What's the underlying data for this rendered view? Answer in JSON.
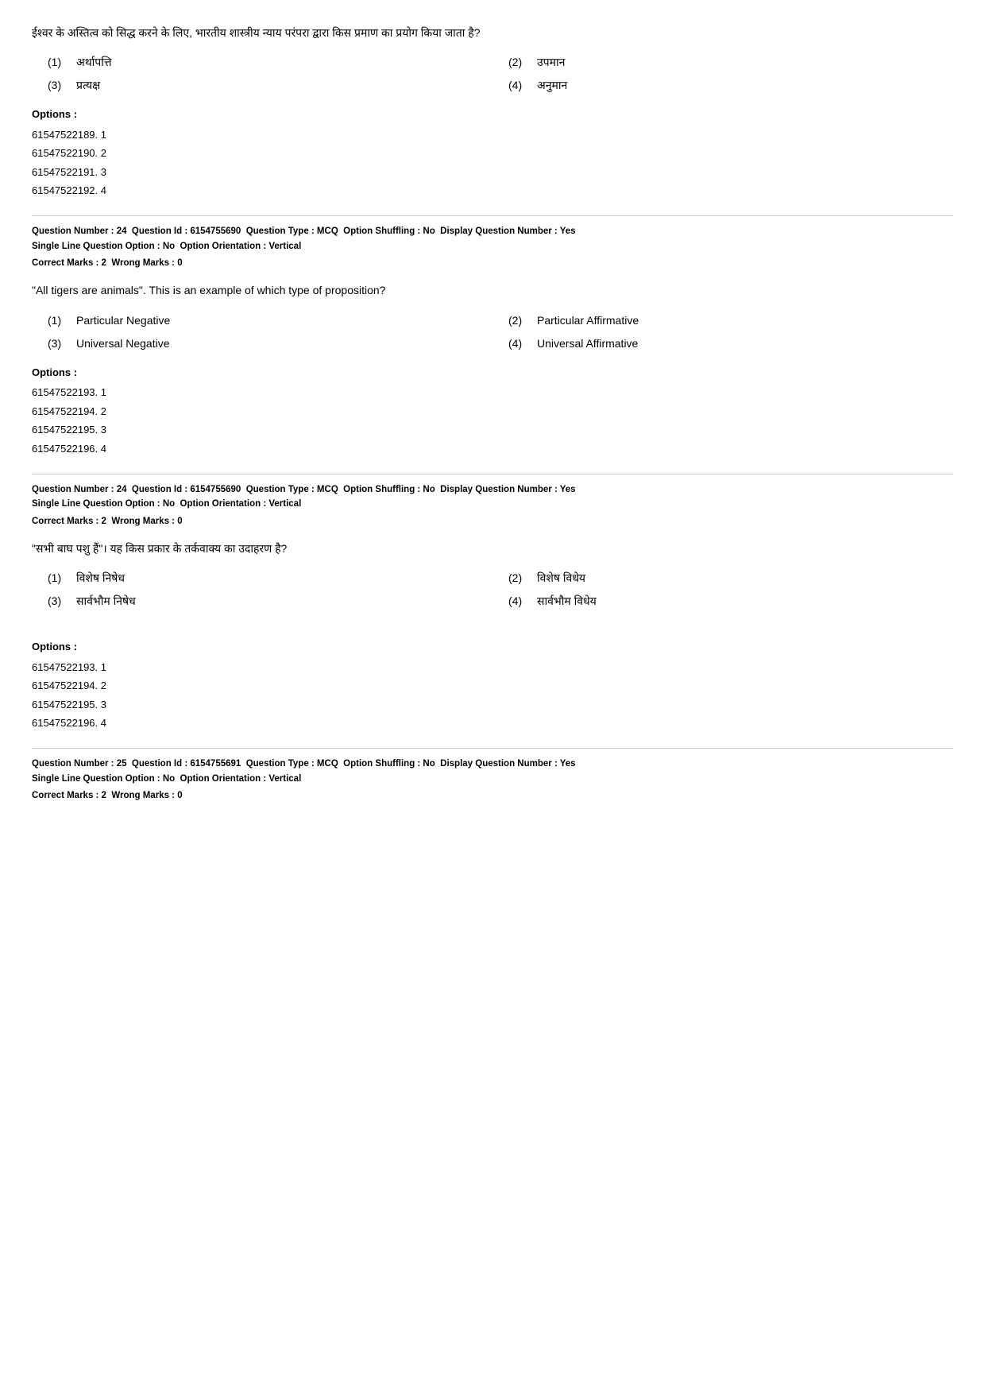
{
  "sections": [
    {
      "id": "section-q23-hindi",
      "question_text": "ईश्वर के अस्तित्व को सिद्ध करने के लिए, भारतीय शास्त्रीय न्याय परंपरा द्वारा किस प्रमाण का प्रयोग किया जाता है?",
      "options": [
        {
          "num": "(1)",
          "text": "अर्थापत्ति"
        },
        {
          "num": "(2)",
          "text": "उपमान"
        },
        {
          "num": "(3)",
          "text": "प्रत्यक्ष"
        },
        {
          "num": "(4)",
          "text": "अनुमान"
        }
      ],
      "options_label": "Options :",
      "options_values": [
        "61547522189. 1",
        "61547522190. 2",
        "61547522191. 3",
        "61547522192. 4"
      ]
    },
    {
      "id": "section-q24-meta",
      "meta_line1": "Question Number : 24  Question Id : 6154755690  Question Type : MCQ  Option Shuffling : No  Display Question Number : Yes",
      "meta_line2": "Single Line Question Option : No  Option Orientation : Vertical",
      "correct_marks": "Correct Marks : 2  Wrong Marks : 0"
    },
    {
      "id": "section-q24-english",
      "question_text": "\"All tigers are animals\". This is an example of which type of proposition?",
      "options": [
        {
          "num": "(1)",
          "text": "Particular Negative"
        },
        {
          "num": "(2)",
          "text": "Particular Affirmative"
        },
        {
          "num": "(3)",
          "text": "Universal Negative"
        },
        {
          "num": "(4)",
          "text": "Universal Affirmative"
        }
      ],
      "options_label": "Options :",
      "options_values": [
        "61547522193. 1",
        "61547522194. 2",
        "61547522195. 3",
        "61547522196. 4"
      ]
    },
    {
      "id": "section-q24-meta2",
      "meta_line1": "Question Number : 24  Question Id : 6154755690  Question Type : MCQ  Option Shuffling : No  Display Question Number : Yes",
      "meta_line2": "Single Line Question Option : No  Option Orientation : Vertical",
      "correct_marks": "Correct Marks : 2  Wrong Marks : 0"
    },
    {
      "id": "section-q24-hindi",
      "question_text": "\"सभी बाघ पशु हैं\"। यह किस प्रकार के तर्कवाक्य का उदाहरण है?",
      "options": [
        {
          "num": "(1)",
          "text": "विशेष निषेध"
        },
        {
          "num": "(2)",
          "text": "विशेष विधेय"
        },
        {
          "num": "(3)",
          "text": "सार्वभौम निषेध"
        },
        {
          "num": "(4)",
          "text": "सार्वभौम विधेय"
        }
      ],
      "options_label": "Options :",
      "options_values": [
        "61547522193. 1",
        "61547522194. 2",
        "61547522195. 3",
        "61547522196. 4"
      ]
    },
    {
      "id": "section-q25-meta",
      "meta_line1": "Question Number : 25  Question Id : 6154755691  Question Type : MCQ  Option Shuffling : No  Display Question Number : Yes",
      "meta_line2": "Single Line Question Option : No  Option Orientation : Vertical",
      "correct_marks": "Correct Marks : 2  Wrong Marks : 0"
    }
  ]
}
